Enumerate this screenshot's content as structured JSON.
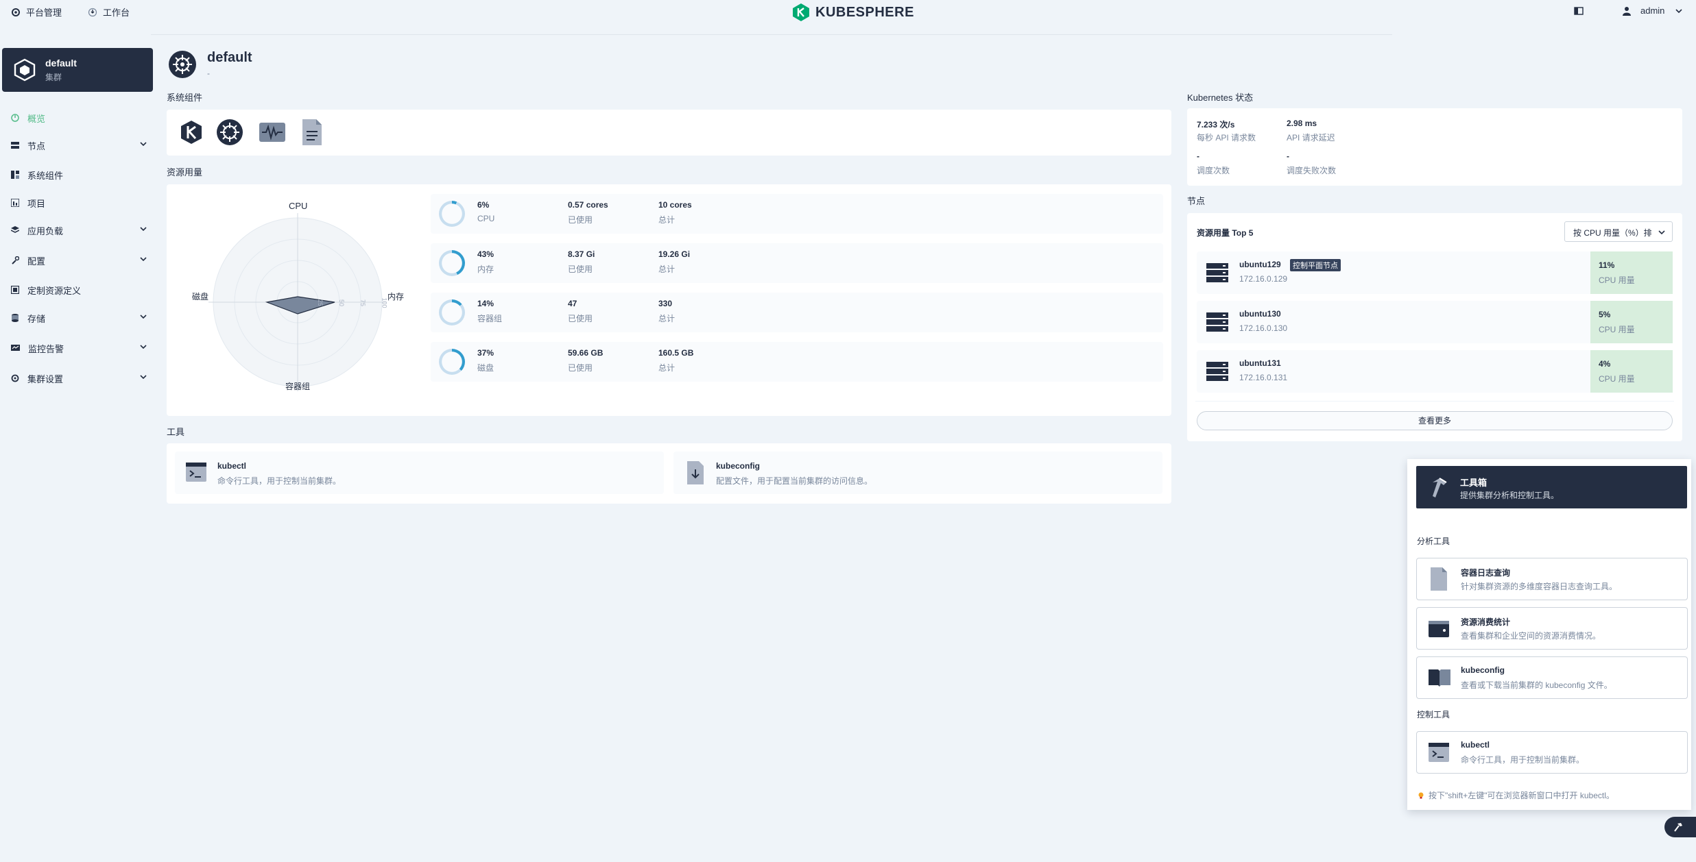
{
  "topbar": {
    "platform_label": "平台管理",
    "workbench_label": "工作台",
    "brand": "KUBESPHERE",
    "user": "admin"
  },
  "cluster": {
    "name": "default",
    "type": "集群"
  },
  "sidebar": {
    "items": [
      {
        "label": "概览",
        "active": true,
        "expandable": false
      },
      {
        "label": "节点",
        "expandable": true
      },
      {
        "label": "系统组件",
        "expandable": false
      },
      {
        "label": "项目",
        "expandable": false
      },
      {
        "label": "应用负载",
        "expandable": true
      },
      {
        "label": "配置",
        "expandable": true
      },
      {
        "label": "定制资源定义",
        "expandable": false
      },
      {
        "label": "存储",
        "expandable": true
      },
      {
        "label": "监控告警",
        "expandable": true
      },
      {
        "label": "集群设置",
        "expandable": true
      }
    ]
  },
  "page": {
    "title": "default",
    "subtitle": "-"
  },
  "system_components": {
    "title": "系统组件"
  },
  "resource_usage": {
    "title": "资源用量",
    "radar_labels": {
      "top": "CPU",
      "right": "内存",
      "bottom": "容器组",
      "left": "磁盘"
    },
    "radar_ticks": [
      "25",
      "50",
      "75",
      "100"
    ],
    "rows": [
      {
        "percent": "6%",
        "name": "CPU",
        "used": "0.57 cores",
        "used_label": "已使用",
        "total": "10 cores",
        "total_label": "总计",
        "fraction": 0.06
      },
      {
        "percent": "43%",
        "name": "内存",
        "used": "8.37 Gi",
        "used_label": "已使用",
        "total": "19.26 Gi",
        "total_label": "总计",
        "fraction": 0.43
      },
      {
        "percent": "14%",
        "name": "容器组",
        "used": "47",
        "used_label": "已使用",
        "total": "330",
        "total_label": "总计",
        "fraction": 0.14
      },
      {
        "percent": "37%",
        "name": "磁盘",
        "used": "59.66 GB",
        "used_label": "已使用",
        "total": "160.5 GB",
        "total_label": "总计",
        "fraction": 0.37
      }
    ]
  },
  "tools": {
    "title": "工具",
    "items": [
      {
        "name": "kubectl",
        "desc": "命令行工具，用于控制当前集群。"
      },
      {
        "name": "kubeconfig",
        "desc": "配置文件，用于配置当前集群的访问信息。"
      }
    ]
  },
  "k8s_status": {
    "title": "Kubernetes 状态",
    "metrics": [
      {
        "value": "7.233 次/s",
        "label": "每秒 API 请求数"
      },
      {
        "value": "2.98 ms",
        "label": "API 请求延迟"
      },
      {
        "value": "-",
        "label": "调度次数"
      },
      {
        "value": "-",
        "label": "调度失败次数"
      }
    ]
  },
  "nodes": {
    "title": "节点",
    "top_title": "资源用量 Top 5",
    "sort_select": "按 CPU 用量（%）排",
    "items": [
      {
        "name": "ubuntu129",
        "badge": "控制平面节点",
        "ip": "172.16.0.129",
        "percent": "11%",
        "metric": "CPU 用量"
      },
      {
        "name": "ubuntu130",
        "badge": "",
        "ip": "172.16.0.130",
        "percent": "5%",
        "metric": "CPU 用量"
      },
      {
        "name": "ubuntu131",
        "badge": "",
        "ip": "172.16.0.131",
        "percent": "4%",
        "metric": "CPU 用量"
      }
    ],
    "more_button": "查看更多"
  },
  "toolbox": {
    "title": "工具箱",
    "desc": "提供集群分析和控制工具。",
    "analysis_title": "分析工具",
    "analysis_items": [
      {
        "name": "容器日志查询",
        "desc": "针对集群资源的多维度容器日志查询工具。"
      },
      {
        "name": "资源消费统计",
        "desc": "查看集群和企业空间的资源消费情况。"
      },
      {
        "name": "kubeconfig",
        "desc": "查看或下载当前集群的 kubeconfig 文件。"
      }
    ],
    "control_title": "控制工具",
    "control_items": [
      {
        "name": "kubectl",
        "desc": "命令行工具，用于控制当前集群。"
      }
    ],
    "tip": "按下\"shift+左键\"可在浏览器新窗口中打开 kubectl。"
  }
}
